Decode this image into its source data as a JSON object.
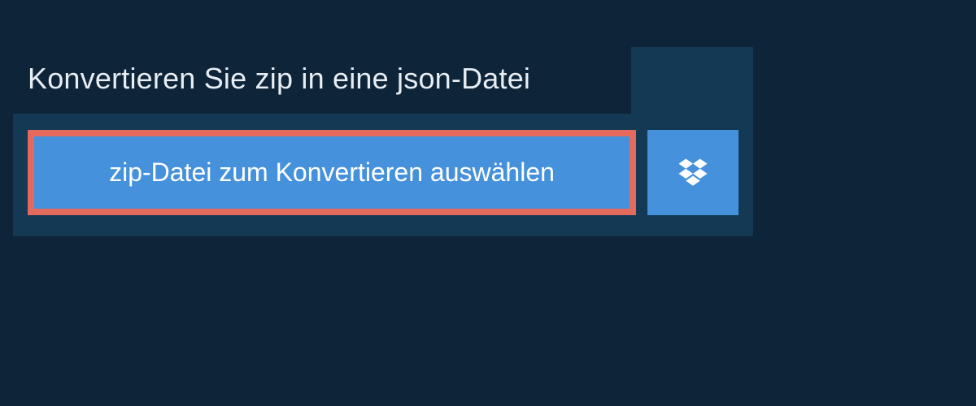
{
  "title": "Konvertieren Sie zip in eine json-Datei",
  "buttons": {
    "select_file": "zip-Datei zum Konvertieren auswählen"
  }
}
